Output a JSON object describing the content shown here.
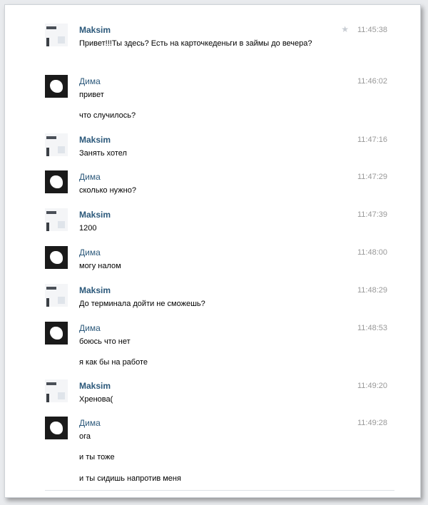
{
  "messages": [
    {
      "author": "Maksim",
      "time": "11:45:38",
      "lines": [
        "Привет!!!Ты здесь? Есть на карточкеденьги в займы до вечера?"
      ]
    },
    {
      "author": "Дима",
      "time": "11:46:02",
      "lines": [
        "привет",
        "что случилось?"
      ]
    },
    {
      "author": "Maksim",
      "time": "11:47:16",
      "lines": [
        "Занять хотел"
      ]
    },
    {
      "author": "Дима",
      "time": "11:47:29",
      "lines": [
        "сколько нужно?"
      ]
    },
    {
      "author": "Maksim",
      "time": "11:47:39",
      "lines": [
        "1200"
      ]
    },
    {
      "author": "Дима",
      "time": "11:48:00",
      "lines": [
        "могу налом"
      ]
    },
    {
      "author": "Maksim",
      "time": "11:48:29",
      "lines": [
        "До терминала дойти не сможешь?"
      ]
    },
    {
      "author": "Дима",
      "time": "11:48:53",
      "lines": [
        "боюсь что нет",
        "я как бы на работе"
      ]
    },
    {
      "author": "Maksim",
      "time": "11:49:20",
      "lines": [
        "Хренова("
      ]
    },
    {
      "author": "Дима",
      "time": "11:49:28",
      "lines": [
        "ога",
        "и ты тоже",
        "и ты сидишь напротив меня"
      ]
    }
  ],
  "icons": {
    "favorite": "star-icon"
  },
  "colors": {
    "author": "#2b587a",
    "time": "#999999",
    "text": "#000000"
  }
}
